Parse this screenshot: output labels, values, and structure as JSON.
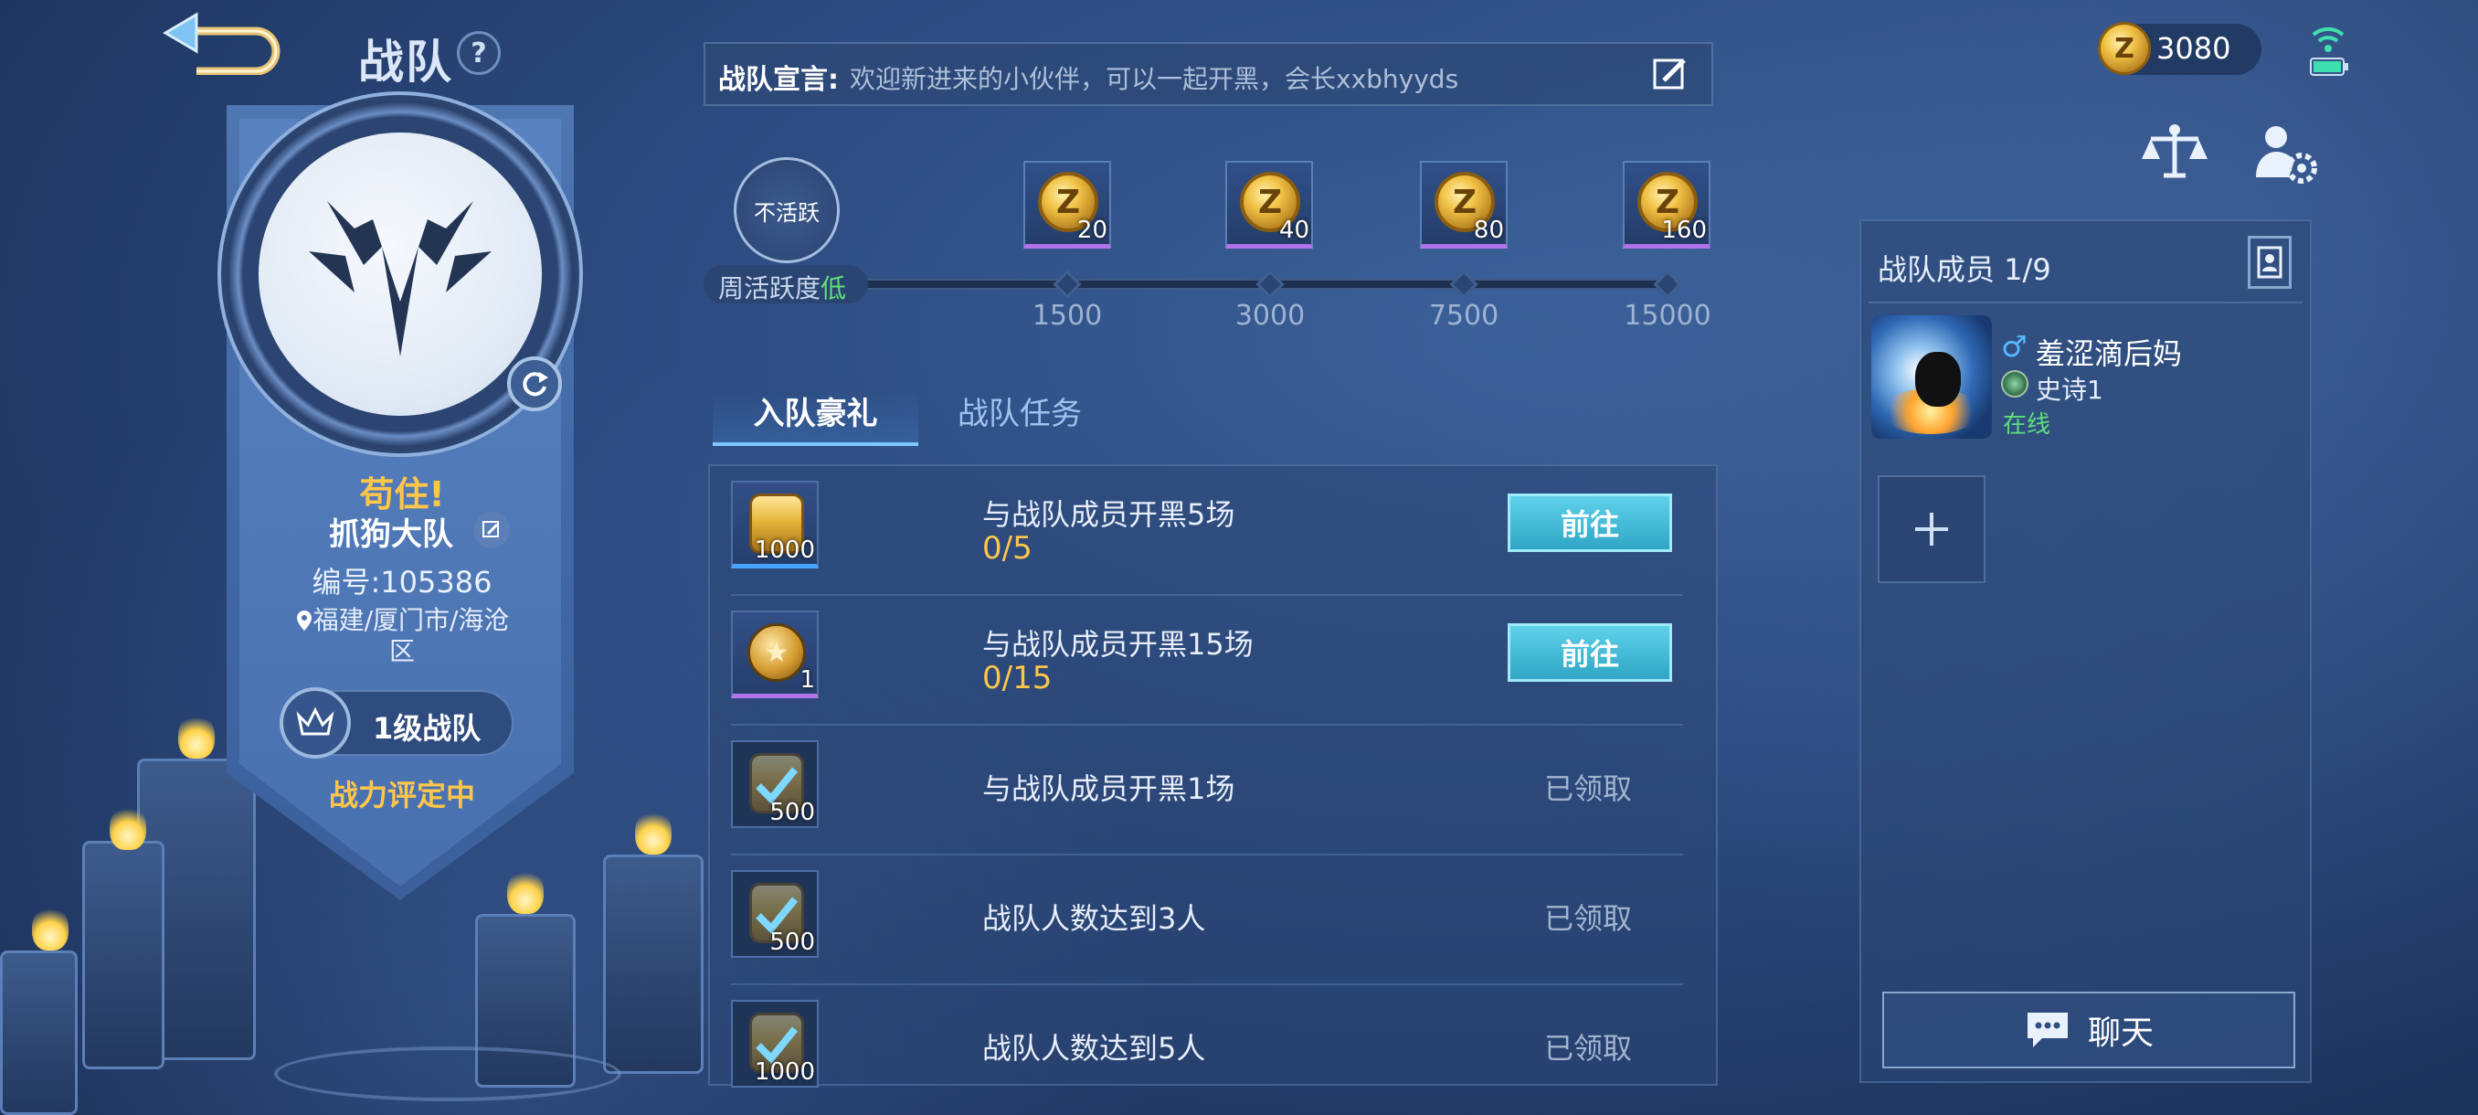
{
  "header": {
    "title": "战队",
    "help_label": "?"
  },
  "team": {
    "slogan": "苟住!",
    "name": "抓狗大队",
    "id_text": "编号:105386",
    "location": "福建/厦门市/海沧区",
    "level": "1级战队",
    "power_status": "战力评定中"
  },
  "declaration": {
    "label": "战队宣言:",
    "text": "欢迎新进来的小伙伴，可以一起开黑，会长xxbhyyds"
  },
  "activity": {
    "status_label": "不活跃",
    "weekly_label": "周活跃度",
    "weekly_level": "低",
    "current": 0,
    "milestones": [
      {
        "threshold": "1500",
        "reward_qty": "20",
        "coin_glyph": "Z"
      },
      {
        "threshold": "3000",
        "reward_qty": "40",
        "coin_glyph": "Z"
      },
      {
        "threshold": "7500",
        "reward_qty": "80",
        "coin_glyph": "Z"
      },
      {
        "threshold": "15000",
        "reward_qty": "160",
        "coin_glyph": "Z"
      }
    ]
  },
  "tabs": [
    {
      "label": "入队豪礼",
      "active": true
    },
    {
      "label": "战队任务",
      "active": false
    }
  ],
  "tasks": [
    {
      "title": "与战队成员开黑5场",
      "progress": "0/5",
      "reward_qty": "1000",
      "reward_type": "coin-stack",
      "action": "前往",
      "state": "go"
    },
    {
      "title": "与战队成员开黑15场",
      "progress": "0/15",
      "reward_qty": "1",
      "reward_type": "badge",
      "action": "前往",
      "state": "go"
    },
    {
      "title": "与战队成员开黑1场",
      "progress": "",
      "reward_qty": "500",
      "reward_type": "claimed",
      "action": "已领取",
      "state": "claimed"
    },
    {
      "title": "战队人数达到3人",
      "progress": "",
      "reward_qty": "500",
      "reward_type": "claimed",
      "action": "已领取",
      "state": "claimed"
    },
    {
      "title": "战队人数达到5人",
      "progress": "",
      "reward_qty": "1000",
      "reward_type": "claimed",
      "action": "已领取",
      "state": "claimed"
    }
  ],
  "currency": {
    "glyph": "Z",
    "amount": "3080"
  },
  "members": {
    "title": "战队成员 1/9",
    "list": [
      {
        "gender": "♂",
        "name": "羞涩滴后妈",
        "rank": "史诗1",
        "status": "在线"
      }
    ]
  },
  "chat": {
    "label": "聊天"
  },
  "colors": {
    "accent_gold": "#ffc64a",
    "online_green": "#5ee07a",
    "button_cyan": "#2fa6c6",
    "panel_blue": "#2c4875"
  }
}
